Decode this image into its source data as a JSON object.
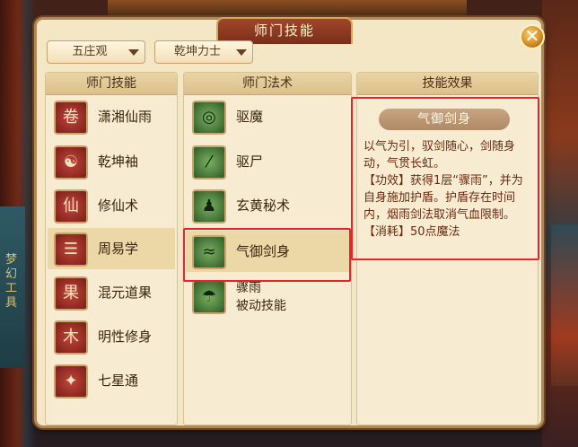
{
  "window": {
    "title": "师门技能",
    "close_glyph": "✕"
  },
  "dropdowns": [
    {
      "value": "五庄观"
    },
    {
      "value": "乾坤力士"
    }
  ],
  "columns": {
    "skills_header": "师门技能",
    "spells_header": "师门法术",
    "effect_header": "技能效果"
  },
  "skills": [
    {
      "label": "潇湘仙雨",
      "icon": "scroll-icon"
    },
    {
      "label": "乾坤袖",
      "icon": "yinyang-icon"
    },
    {
      "label": "修仙术",
      "icon": "immortal-figure-icon"
    },
    {
      "label": "周易学",
      "icon": "bagua-icon",
      "selected": true
    },
    {
      "label": "混元道果",
      "icon": "fruit-icon"
    },
    {
      "label": "明性修身",
      "icon": "tree-icon"
    },
    {
      "label": "七星通",
      "icon": "stars-icon"
    }
  ],
  "spells": [
    {
      "label": "驱魔",
      "icon": "gourd-icon"
    },
    {
      "label": "驱尸",
      "icon": "whisk-icon"
    },
    {
      "label": "玄黄秘术",
      "icon": "meditation-icon"
    },
    {
      "label": "气御剑身",
      "icon": "sword-qi-icon",
      "selected": true
    },
    {
      "label": "骤雨",
      "sub": "被动技能",
      "icon": "rain-icon"
    }
  ],
  "effect": {
    "title": "气御剑身",
    "desc": "以气为引，驭剑随心，剑随身动，气贯长虹。",
    "effect": "【功效】获得1层“骤雨”，并为自身施加护盾。护盾存在时间内，烟雨剑法取消气血限制。",
    "cost": "【消耗】50点魔法"
  },
  "background_text": "梦幻工具",
  "colors": {
    "highlight": "#e8242a",
    "title_bg": "#a0462a",
    "panel_bg": "#f4e7c6"
  }
}
